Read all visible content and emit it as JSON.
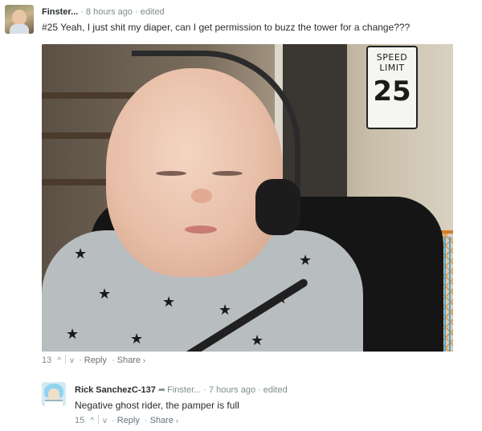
{
  "comments": [
    {
      "author": "Finster...",
      "time": "8 hours ago",
      "edited": "edited",
      "text": "#25 Yeah, I just shit my diaper, can I get permission to buzz the tower for a change???",
      "image": {
        "sign_line1": "SPEED",
        "sign_line2": "LIMIT",
        "sign_number": "25"
      },
      "votes": "13",
      "reply_label": "Reply",
      "share_label": "Share"
    },
    {
      "author": "Rick SanchezC-137",
      "in_reply_to": "Finster...",
      "time": "7 hours ago",
      "edited": "edited",
      "text": "Negative ghost rider, the pamper is full",
      "votes": "15",
      "reply_label": "Reply",
      "share_label": "Share"
    }
  ],
  "icons": {
    "upvote": "caret-up",
    "downvote": "caret-down",
    "reply_arrow": "arrow-right",
    "share_chevron": "chevron-right"
  },
  "colors": {
    "text": "#2a2e2e",
    "meta": "#7f8c8d"
  }
}
